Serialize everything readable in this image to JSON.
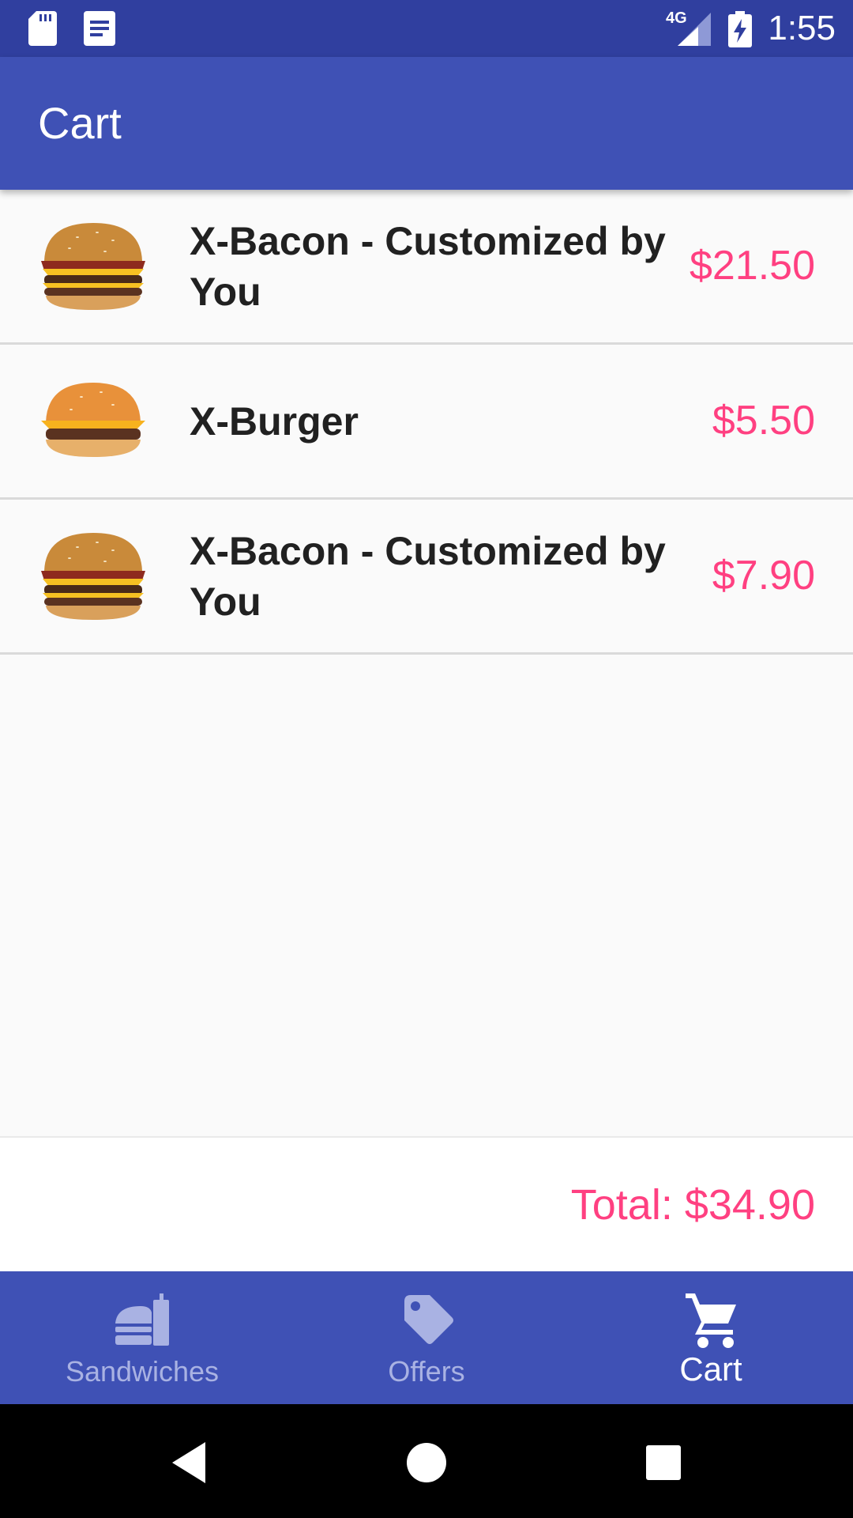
{
  "status_bar": {
    "time": "1:55",
    "network": "4G",
    "icons": [
      "sd-card-icon",
      "notification-doc-icon",
      "signal-4g-icon",
      "battery-charging-icon"
    ]
  },
  "app_bar": {
    "title": "Cart"
  },
  "cart": {
    "items": [
      {
        "name": "X-Bacon - Customized by You",
        "price": "$21.50",
        "image": "x-bacon-burger-icon"
      },
      {
        "name": "X-Burger",
        "price": "$5.50",
        "image": "x-burger-icon"
      },
      {
        "name": "X-Bacon - Customized by You",
        "price": "$7.90",
        "image": "x-bacon-burger-icon"
      }
    ],
    "total": "Total: $34.90"
  },
  "bottom_nav": {
    "tabs": [
      {
        "label": "Sandwiches",
        "icon": "sandwich-icon",
        "active": false
      },
      {
        "label": "Offers",
        "icon": "tag-icon",
        "active": false
      },
      {
        "label": "Cart",
        "icon": "cart-icon",
        "active": true
      }
    ]
  },
  "colors": {
    "primary": "#3F51B5",
    "primary_dark": "#303F9F",
    "accent": "#FF4081",
    "inactive_tab": "#A9B2E3"
  }
}
